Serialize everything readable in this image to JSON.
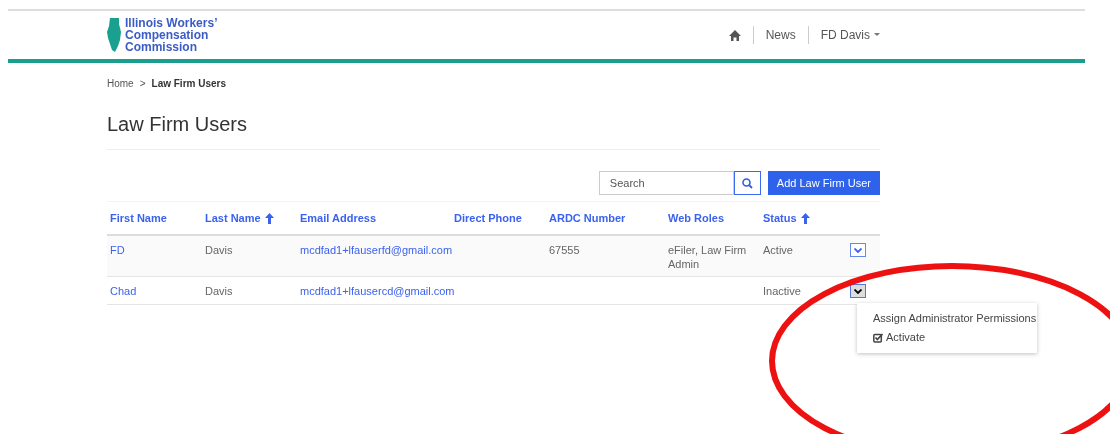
{
  "header": {
    "logo_text": "Illinois Workers’ Compensation Commission",
    "nav": [
      {
        "kind": "icon"
      },
      {
        "kind": "link",
        "label": "News"
      },
      {
        "kind": "menu",
        "label": "FD Davis"
      }
    ]
  },
  "breadcrumb": [
    {
      "label": "Home",
      "current": false
    },
    {
      "label": "Law Firm Users",
      "current": true
    }
  ],
  "breadcrumb_separator": ">",
  "title": "Law Firm Users",
  "search": {
    "placeholder": "Search"
  },
  "add_button": "Add Law Firm User",
  "table": {
    "columns": [
      {
        "label": "First Name",
        "sorted": false
      },
      {
        "label": "Last Name",
        "sorted": true
      },
      {
        "label": "Email Address",
        "sorted": false
      },
      {
        "label": "Direct Phone",
        "sorted": false
      },
      {
        "label": "ARDC Number",
        "sorted": false
      },
      {
        "label": "Web Roles",
        "sorted": false
      },
      {
        "label": "Status",
        "sorted": true
      }
    ],
    "rows": [
      {
        "cells": [
          "FD",
          "Davis",
          "mcdfad1+lfauserfd@gmail.com",
          "",
          "67555",
          "eFiler, Law Firm Admin",
          "Active"
        ],
        "highlighted": true,
        "menu_open": false
      },
      {
        "cells": [
          "Chad",
          "Davis",
          "mcdfad1+lfausercd@gmail.com",
          "",
          "",
          "",
          "Inactive"
        ],
        "highlighted": false,
        "menu_open": true,
        "menu": [
          {
            "label": "Assign Administrator Permissions",
            "kind": "plain"
          },
          {
            "label": "Activate",
            "kind": "check"
          }
        ]
      }
    ]
  },
  "annotation": {
    "kind": "ellipse"
  }
}
